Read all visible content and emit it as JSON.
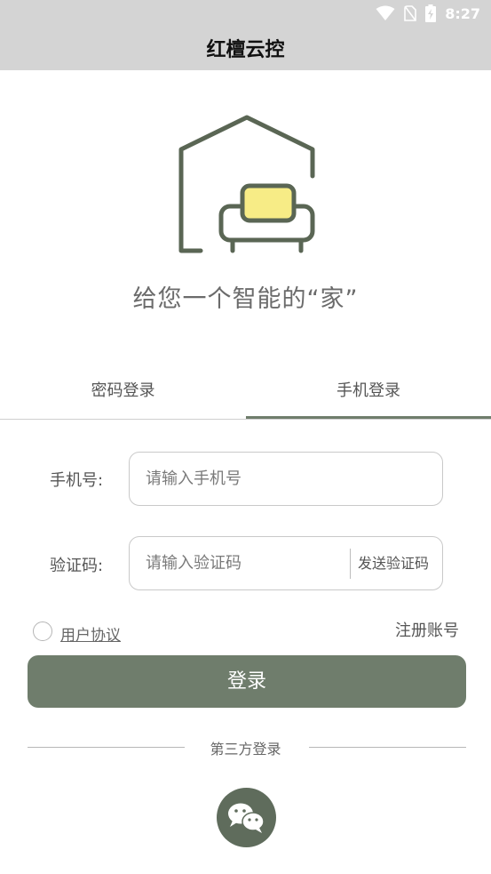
{
  "status_bar": {
    "time": "8:27"
  },
  "app": {
    "title": "红檀云控"
  },
  "hero": {
    "slogan": "给您一个智能的“家”"
  },
  "tabs": [
    {
      "label": "密码登录",
      "active": false
    },
    {
      "label": "手机登录",
      "active": true
    }
  ],
  "form": {
    "phone_label": "手机号:",
    "phone_placeholder": "请输入手机号",
    "phone_value": "",
    "code_label": "验证码:",
    "code_placeholder": "请输入验证码",
    "code_value": "",
    "send_code_label": "发送验证码"
  },
  "agreement": {
    "label": "用户协议",
    "checked": false
  },
  "register": {
    "label": "注册账号"
  },
  "login_button": {
    "label": "登录"
  },
  "third_party": {
    "label": "第三方登录",
    "providers": [
      "wechat-icon"
    ]
  },
  "colors": {
    "accent": "#6f7d6c",
    "logo_stroke": "#5a6654",
    "logo_cushion": "#f7ec86",
    "bar_bg": "#d4d4d4"
  }
}
